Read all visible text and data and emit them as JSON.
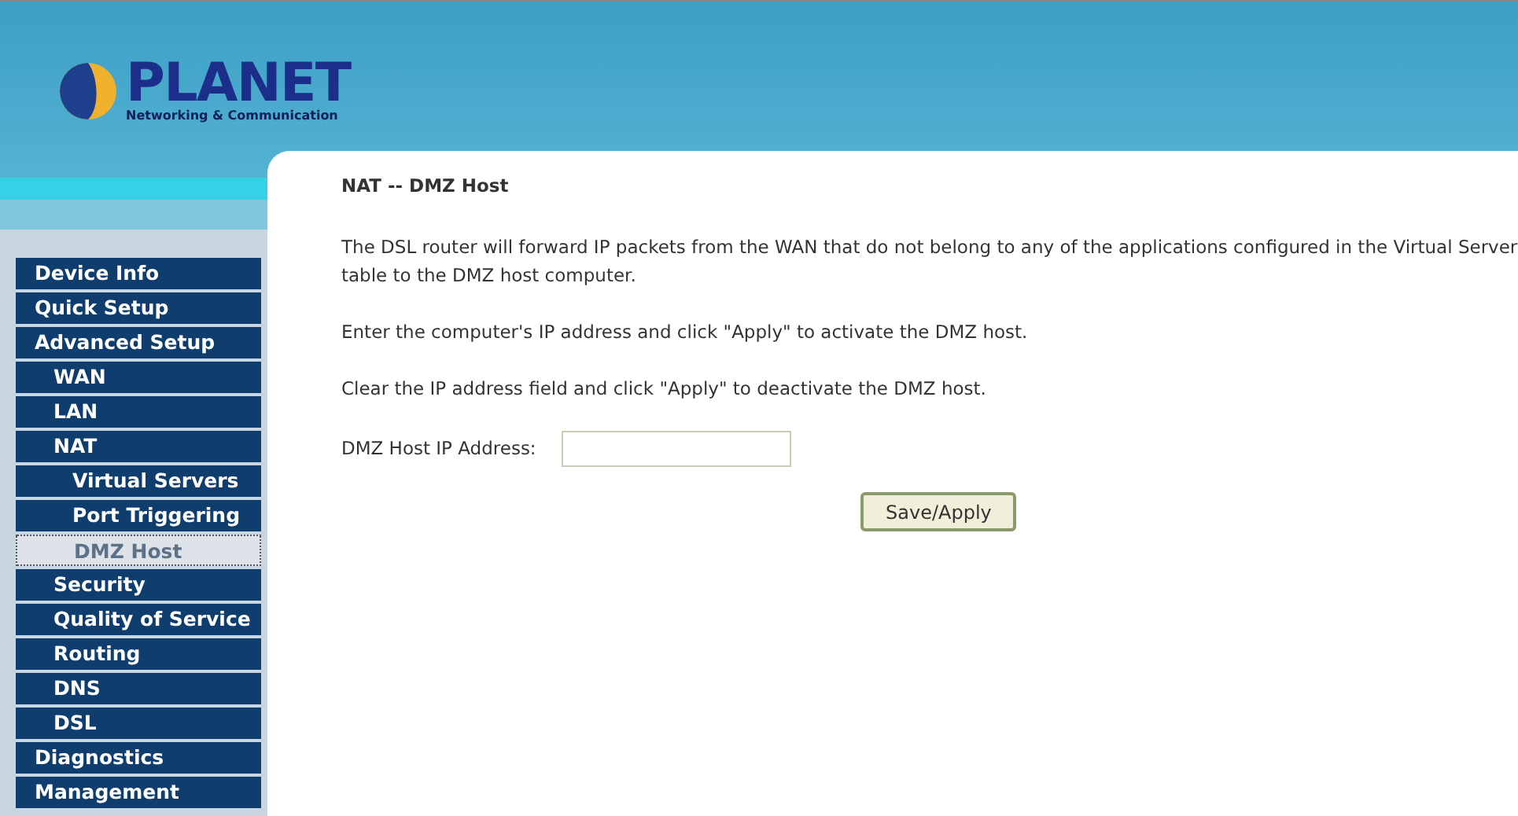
{
  "logo": {
    "name": "PLANET",
    "tagline": "Networking & Communication"
  },
  "sidebar": {
    "items": [
      {
        "label": "Device Info",
        "selected": false
      },
      {
        "label": "Quick Setup",
        "selected": false
      },
      {
        "label": "Advanced Setup",
        "selected": false,
        "children": [
          {
            "label": "WAN",
            "selected": false
          },
          {
            "label": "LAN",
            "selected": false
          },
          {
            "label": "NAT",
            "selected": false,
            "children": [
              {
                "label": "Virtual Servers",
                "selected": false
              },
              {
                "label": "Port Triggering",
                "selected": false
              },
              {
                "label": "DMZ Host",
                "selected": true
              }
            ]
          },
          {
            "label": "Security",
            "selected": false
          },
          {
            "label": "Quality of Service",
            "selected": false
          },
          {
            "label": "Routing",
            "selected": false
          },
          {
            "label": "DNS",
            "selected": false
          },
          {
            "label": "DSL",
            "selected": false
          }
        ]
      },
      {
        "label": "Diagnostics",
        "selected": false
      },
      {
        "label": "Management",
        "selected": false
      }
    ]
  },
  "content": {
    "title": "NAT -- DMZ Host",
    "description_lines": [
      "The DSL router will forward IP packets from the WAN that do not belong to any of the applications configured in the Virtual Server",
      "table to the DMZ host computer."
    ],
    "paragraphs": [
      "Enter the computer's IP address and click \"Apply\" to activate the DMZ host.",
      "Clear the IP address field and click \"Apply\" to deactivate the DMZ host."
    ],
    "field": {
      "label": "DMZ Host IP Address:"
    },
    "button": "Save/Apply"
  }
}
